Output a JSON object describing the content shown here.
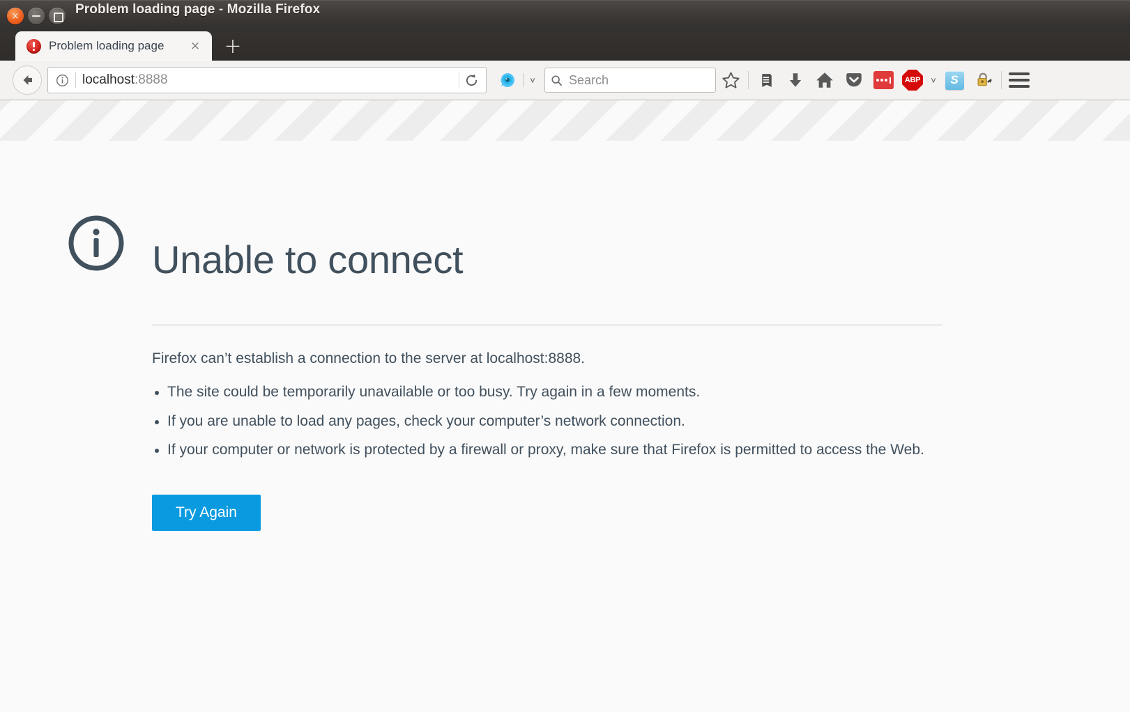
{
  "window": {
    "title": "Problem loading page - Mozilla Firefox",
    "close_label": "×",
    "minimize_label": "−",
    "maximize_label": "□"
  },
  "tabs": {
    "items": [
      {
        "label": "Problem loading page",
        "favicon": "error-favicon",
        "close_label": "×"
      }
    ],
    "new_tab_label": "+"
  },
  "toolbar": {
    "back_icon": "back-arrow-icon",
    "identity_icon": "info-identity-icon",
    "url_host": "localhost",
    "url_port": ":8888",
    "url_full": "localhost:8888",
    "reload_icon": "reload-icon",
    "search_engine_icon": "search-engine-globe-icon",
    "engine_chevron": "˅",
    "search_icon": "search-icon",
    "search_placeholder": "Search",
    "search_value": "",
    "bookmark_icon": "star-icon",
    "reader_icon": "reading-list-icon",
    "download_icon": "download-arrow-icon",
    "home_icon": "home-icon",
    "pocket_icon": "pocket-icon",
    "extension_dots_icon": "dots-extension-icon",
    "adblock_label": "ABP",
    "adblock_chevron": "˅",
    "skype_label": "S",
    "password_icon": "padlock-key-icon",
    "menu_icon": "hamburger-menu-icon"
  },
  "error_page": {
    "icon": "info-circle-icon",
    "title": "Unable to connect",
    "intro": "Firefox can’t establish a connection to the server at localhost:8888.",
    "suggestions": [
      "The site could be temporarily unavailable or too busy. Try again in a few moments.",
      "If you are unable to load any pages, check your computer’s network connection.",
      "If your computer or network is protected by a firewall or proxy, make sure that Firefox is permitted to access the Web."
    ],
    "button_label": "Try Again"
  },
  "colors": {
    "accent_blue": "#0a9ae0",
    "text_slate": "#41505d",
    "page_background": "#fafafa",
    "toolbar_background": "#f4f2f0",
    "titlebar_background": "#3a3735",
    "adblock_red": "#d60a0a",
    "extension_red": "#df3b3b"
  }
}
